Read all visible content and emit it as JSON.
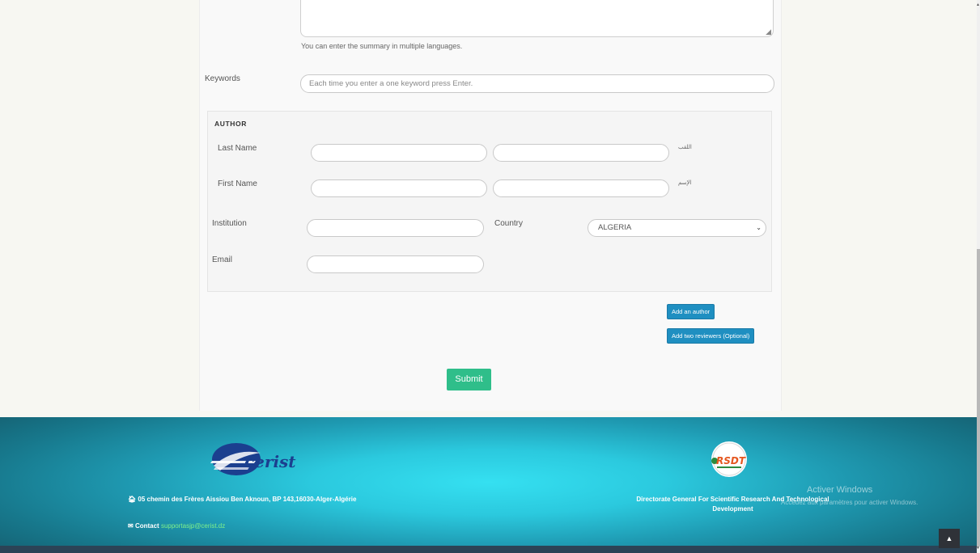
{
  "summary": {
    "help_text": "You can enter the summary in multiple languages."
  },
  "keywords": {
    "label": "Keywords",
    "placeholder": "Each time you enter a one keyword press Enter."
  },
  "author": {
    "section_title": "AUTHOR",
    "last_name_label": "Last Name",
    "last_name_ar_label": "اللقب",
    "first_name_label": "First Name",
    "first_name_ar_label": "الإسم",
    "institution_label": "Institution",
    "country_label": "Country",
    "country_selected": "ALGERIA",
    "email_label": "Email"
  },
  "buttons": {
    "add_author": "Add an author",
    "add_reviewers": "Add two reviewers (Optional)",
    "submit": "Submit"
  },
  "footer": {
    "address": "05 chemin des Frères Aissiou Ben Aknoun, BP 143,16030-Alger-Algérie",
    "contact_label": "Contact",
    "contact_email": "supportasjp@cerist.dz",
    "org_name": "Directorate General For Scientific Research And Technological Development",
    "cerist_logo_text": "cerist",
    "rsdt_logo_text": "RSDT"
  },
  "os_watermark": {
    "title": "Activer Windows",
    "subtitle": "Accédez aux paramètres pour activer Windows."
  },
  "colors": {
    "submit": "#2fbe8a",
    "action_blue": "#1f8fc1",
    "footer_cyan": "#2bc9de",
    "link_green": "#7ff08a"
  }
}
